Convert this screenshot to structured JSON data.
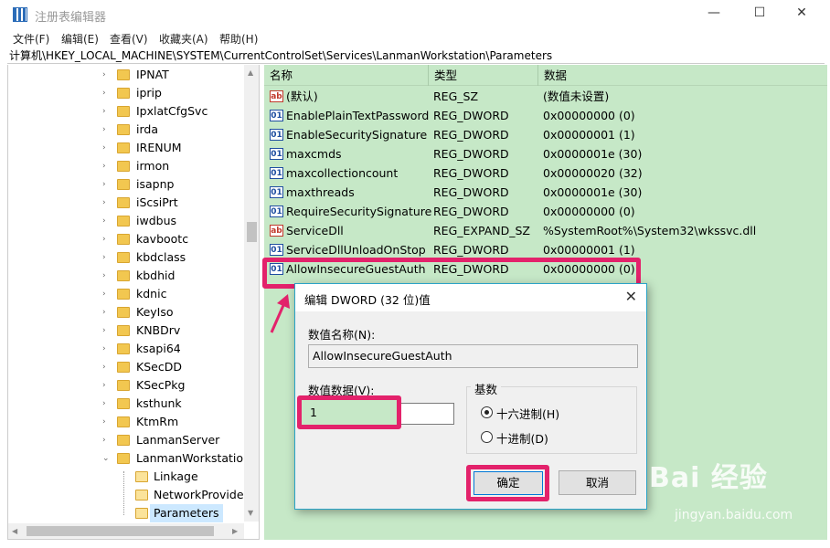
{
  "window": {
    "title": "注册表编辑器",
    "minimize": "—",
    "maximize": "☐",
    "close": "✕"
  },
  "menu": [
    "文件(F)",
    "编辑(E)",
    "查看(V)",
    "收藏夹(A)",
    "帮助(H)"
  ],
  "address": "计算机\\HKEY_LOCAL_MACHINE\\SYSTEM\\CurrentControlSet\\Services\\LanmanWorkstation\\Parameters",
  "tree": [
    {
      "label": "IPNAT",
      "expander": "›"
    },
    {
      "label": "iprip",
      "expander": "›"
    },
    {
      "label": "IpxlatCfgSvc",
      "expander": "›"
    },
    {
      "label": "irda",
      "expander": "›"
    },
    {
      "label": "IRENUM",
      "expander": "›"
    },
    {
      "label": "irmon",
      "expander": "›"
    },
    {
      "label": "isapnp",
      "expander": "›"
    },
    {
      "label": "iScsiPrt",
      "expander": "›"
    },
    {
      "label": "iwdbus",
      "expander": "›"
    },
    {
      "label": "kavbootc",
      "expander": "›"
    },
    {
      "label": "kbdclass",
      "expander": "›"
    },
    {
      "label": "kbdhid",
      "expander": "›"
    },
    {
      "label": "kdnic",
      "expander": "›"
    },
    {
      "label": "KeyIso",
      "expander": "›"
    },
    {
      "label": "KNBDrv",
      "expander": "›"
    },
    {
      "label": "ksapi64",
      "expander": "›"
    },
    {
      "label": "KSecDD",
      "expander": "›"
    },
    {
      "label": "KSecPkg",
      "expander": "›"
    },
    {
      "label": "ksthunk",
      "expander": "›"
    },
    {
      "label": "KtmRm",
      "expander": "›"
    },
    {
      "label": "LanmanServer",
      "expander": "›"
    },
    {
      "label": "LanmanWorkstation",
      "expander": "⌄"
    },
    {
      "label": "Linkage",
      "expander": ""
    },
    {
      "label": "NetworkProvider",
      "expander": ""
    },
    {
      "label": "Parameters",
      "expander": ""
    }
  ],
  "list": {
    "headers": [
      "名称",
      "类型",
      "数据"
    ],
    "rows": [
      {
        "icon": "ab",
        "name": "(默认)",
        "type": "REG_SZ",
        "data": "(数值未设置)"
      },
      {
        "icon": "01",
        "name": "EnablePlainTextPassword",
        "type": "REG_DWORD",
        "data": "0x00000000 (0)"
      },
      {
        "icon": "01",
        "name": "EnableSecuritySignature",
        "type": "REG_DWORD",
        "data": "0x00000001 (1)"
      },
      {
        "icon": "01",
        "name": "maxcmds",
        "type": "REG_DWORD",
        "data": "0x0000001e (30)"
      },
      {
        "icon": "01",
        "name": "maxcollectioncount",
        "type": "REG_DWORD",
        "data": "0x00000020 (32)"
      },
      {
        "icon": "01",
        "name": "maxthreads",
        "type": "REG_DWORD",
        "data": "0x0000001e (30)"
      },
      {
        "icon": "01",
        "name": "RequireSecuritySignature",
        "type": "REG_DWORD",
        "data": "0x00000000 (0)"
      },
      {
        "icon": "ab",
        "name": "ServiceDll",
        "type": "REG_EXPAND_SZ",
        "data": "%SystemRoot%\\System32\\wkssvc.dll"
      },
      {
        "icon": "01",
        "name": "ServiceDllUnloadOnStop",
        "type": "REG_DWORD",
        "data": "0x00000001 (1)"
      },
      {
        "icon": "01",
        "name": "AllowInsecureGuestAuth",
        "type": "REG_DWORD",
        "data": "0x00000000 (0)"
      }
    ]
  },
  "dialog": {
    "title": "编辑 DWORD (32 位)值",
    "close": "✕",
    "name_label": "数值名称(N):",
    "name_value": "AllowInsecureGuestAuth",
    "data_label": "数值数据(V):",
    "data_value": "1",
    "base_label": "基数",
    "hex_label": "十六进制(H)",
    "dec_label": "十进制(D)",
    "ok": "确定",
    "cancel": "取消"
  },
  "watermark": {
    "brand": "Bai 经验",
    "url": "jingyan.baidu.com"
  },
  "colors": {
    "list_bg": "#c6e8c7",
    "highlight": "#e3226b",
    "dialog_border": "#2aa3c7"
  }
}
